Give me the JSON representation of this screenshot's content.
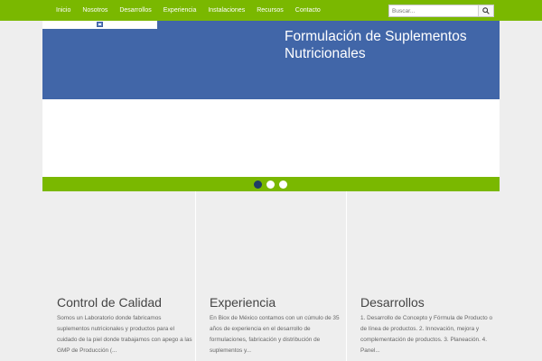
{
  "nav": {
    "items": [
      "Inicio",
      "Nosotros",
      "Desarrollos",
      "Experiencia",
      "Instalaciones",
      "Recursos",
      "Contacto"
    ]
  },
  "search": {
    "placeholder": "Buscar...",
    "icon": "search-icon"
  },
  "hero": {
    "title": "Formulación de Suplementos Nutricionales"
  },
  "slider": {
    "dots": 3,
    "active_index": 0
  },
  "columns": [
    {
      "title": "Control de Calidad",
      "text": "Somos un Laboratorio donde fabricamos suplementos nutricionales y productos para el cuidado de la piel donde trabajamos con apego a las GMP de Producción (..."
    },
    {
      "title": "Experiencia",
      "text": "En Biox de México contamos con un cúmulo de 35 años de experiencia en el desarrollo de formulaciones, fabricación y distribución de suplementos y..."
    },
    {
      "title": "Desarrollos",
      "text": "1. Desarrollo de Concepto y Fórmula de Producto o de línea de productos. 2. Innovación, mejora y complementación de productos. 3. Planeación. 4. Panel..."
    }
  ],
  "colors": {
    "brand_green": "#7ab800",
    "hero_blue": "#4166a8",
    "dot_active": "#1f3c66"
  }
}
